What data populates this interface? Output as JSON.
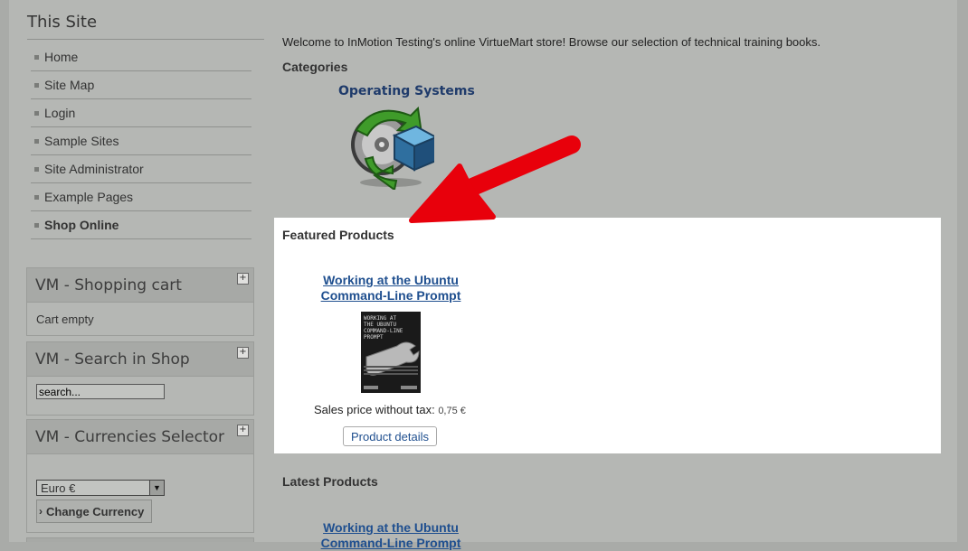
{
  "sidebar": {
    "site_title": "This Site",
    "menu": [
      {
        "label": "Home",
        "active": false
      },
      {
        "label": "Site Map",
        "active": false
      },
      {
        "label": "Login",
        "active": false
      },
      {
        "label": "Sample Sites",
        "active": false
      },
      {
        "label": "Site Administrator",
        "active": false
      },
      {
        "label": "Example Pages",
        "active": false
      },
      {
        "label": "Shop Online",
        "active": true
      }
    ],
    "cart": {
      "title": "VM - Shopping cart",
      "status": "Cart empty"
    },
    "search": {
      "title": "VM - Search in Shop",
      "value": "search..."
    },
    "currency": {
      "title": "VM - Currencies Selector",
      "selected": "Euro €",
      "button": "Change Currency"
    },
    "toggle_symbol": "+"
  },
  "main": {
    "welcome": "Welcome to InMotion Testing's online VirtueMart store! Browse our selection of technical training books.",
    "categories_title": "Categories",
    "category": {
      "name": "Operating Systems",
      "icon": "operating-systems-icon"
    },
    "featured": {
      "title": "Featured Products",
      "product": {
        "title_line1": "Working at the Ubuntu",
        "title_line2": "Command-Line Prompt",
        "price_label": "Sales price without tax:",
        "price_value": "0,75 €",
        "details_button": "Product details"
      }
    },
    "latest": {
      "title": "Latest Products",
      "product": {
        "title_line1": "Working at the Ubuntu",
        "title_line2": "Command-Line Prompt"
      }
    }
  },
  "book_cover": {
    "line1": "WORKING AT",
    "line2": "THE UBUNTU",
    "line3": "COMMAND-LINE",
    "line4": "PROMPT"
  },
  "colors": {
    "page_bg": "#b5b7b4",
    "link": "#1f4f8f",
    "category_link": "#1f3b6b",
    "annotation_arrow": "#e8000b",
    "featured_bg": "#ffffff"
  }
}
